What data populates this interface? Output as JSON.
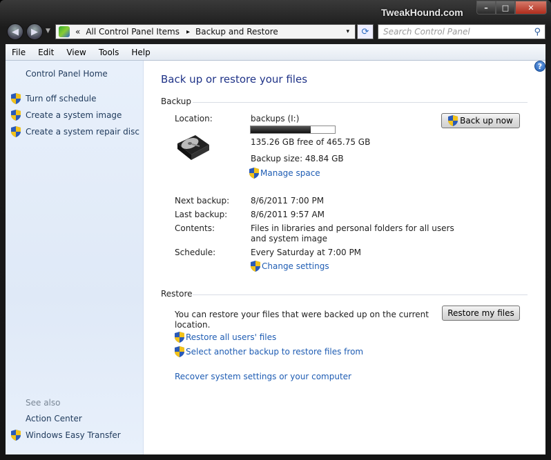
{
  "window": {
    "watermark": "TweakHound.com",
    "caption": {
      "min": "–",
      "max": "□",
      "close": "✕"
    }
  },
  "address": {
    "prefix": "«",
    "segments": [
      "All Control Panel Items",
      "Backup and Restore"
    ],
    "separator": "▸",
    "dropdown": "▾"
  },
  "search": {
    "placeholder": "Search Control Panel"
  },
  "menu": [
    "File",
    "Edit",
    "View",
    "Tools",
    "Help"
  ],
  "sidebar": {
    "home": "Control Panel Home",
    "tasks": [
      "Turn off schedule",
      "Create a system image",
      "Create a system repair disc"
    ],
    "see_also_label": "See also",
    "see_also": [
      "Action Center",
      "Windows Easy Transfer"
    ]
  },
  "main": {
    "title": "Back up or restore your files",
    "backup": {
      "section": "Backup",
      "location_label": "Location:",
      "location_value": "backups (I:)",
      "usage_fraction": 0.71,
      "free_text": "135.26 GB free of 465.75 GB",
      "size_text": "Backup size: 48.84 GB",
      "manage_space": "Manage space",
      "next_label": "Next backup:",
      "next_value": "8/6/2011 7:00 PM",
      "last_label": "Last backup:",
      "last_value": "8/6/2011 9:57 AM",
      "contents_label": "Contents:",
      "contents_line1": "Files in libraries and personal folders for all users",
      "contents_line2": "and system image",
      "schedule_label": "Schedule:",
      "schedule_value": "Every Saturday at 7:00 PM",
      "change_settings": "Change settings",
      "back_up_now": "Back up now"
    },
    "restore": {
      "section": "Restore",
      "text_line1": "You can restore your files that were backed up on the current",
      "text_line2": "location.",
      "restore_all": "Restore all users' files",
      "select_another": "Select another backup to restore files from",
      "recover": "Recover system settings or your computer",
      "restore_my_files": "Restore my files"
    }
  },
  "help_icon": "?"
}
